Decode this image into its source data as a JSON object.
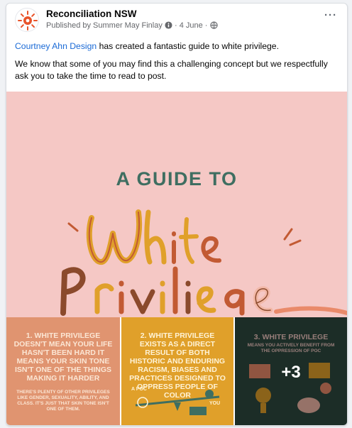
{
  "post": {
    "page_name": "Reconciliation NSW",
    "meta": "Published by Summer May Finlay",
    "date": "4 June",
    "more_label": "···",
    "mention": "Courtney Ahn Design",
    "line1_rest": " has created a fantastic guide to white privilege.",
    "line2": "We know that some of you may find this a challenging concept but we respectfully ask you to take the time to read to post."
  },
  "images": {
    "hero_title": "A GUIDE TO",
    "hero_script": "White Privilege",
    "tile1": {
      "title": "1. WHITE PRIVILEGE DOESN'T MEAN YOUR LIFE HASN'T BEEN HARD IT MEANS YOUR SKIN TONE ISN'T ONE OF THE THINGS MAKING IT HARDER",
      "body": "THERE'S PLENTY OF OTHER PRIVILEGES LIKE GENDER, SEXUALITY, ABILITY, AND CLASS. IT'S JUST THAT SKIN TONE ISN'T ONE OF THEM."
    },
    "tile2": {
      "title": "2. WHITE PRIVILEGE EXISTS AS A DIRECT RESULT OF BOTH HISTORIC AND ENDURING RACISM, BIASES AND PRACTICES DESIGNED TO OPPRESS PEOPLE OF COLOR",
      "label_a": "A POC",
      "label_b": "YOU"
    },
    "tile3": {
      "title": "3. WHITE PRIVILEGE",
      "subtitle": "MEANS YOU ACTIVELY BENEFIT FROM THE OPPRESSION OF POC"
    },
    "more_count": "+3"
  },
  "colors": {
    "link": "#1a6ad6",
    "hero_bg": "#f5c8c5",
    "tile1_bg": "#e09470",
    "tile2_bg": "#e0a02a",
    "tile3_bg": "#2e4940"
  }
}
